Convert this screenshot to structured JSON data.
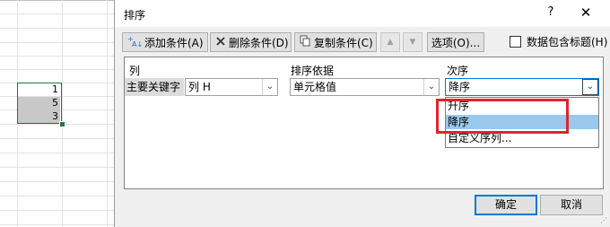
{
  "spreadsheet": {
    "cells": [
      "1",
      "5",
      "3"
    ]
  },
  "dialog": {
    "title": "排序",
    "help_label": "?",
    "close_label": "✕",
    "toolbar": {
      "add_label": "添加条件(A)",
      "delete_label": "删除条件(D)",
      "copy_label": "复制条件(C)",
      "move_up_label": "▲",
      "move_down_label": "▼",
      "options_label": "选项(O)...",
      "header_checkbox_label": "数据包含标题(H)",
      "header_checkbox_checked": false
    },
    "columns": {
      "column": "列",
      "sort_on": "排序依据",
      "order": "次序"
    },
    "rule": {
      "key_label": "主要关键字",
      "column_value": "列 H",
      "sort_on_value": "单元格值",
      "order_value": "降序"
    },
    "order_options": [
      "升序",
      "降序",
      "自定义序列..."
    ],
    "highlighted_option": "降序",
    "ok_label": "确定",
    "cancel_label": "取消"
  },
  "colors": {
    "selection": "#99c9ef",
    "annotation": "#e0242a",
    "excel_green": "#217346"
  }
}
